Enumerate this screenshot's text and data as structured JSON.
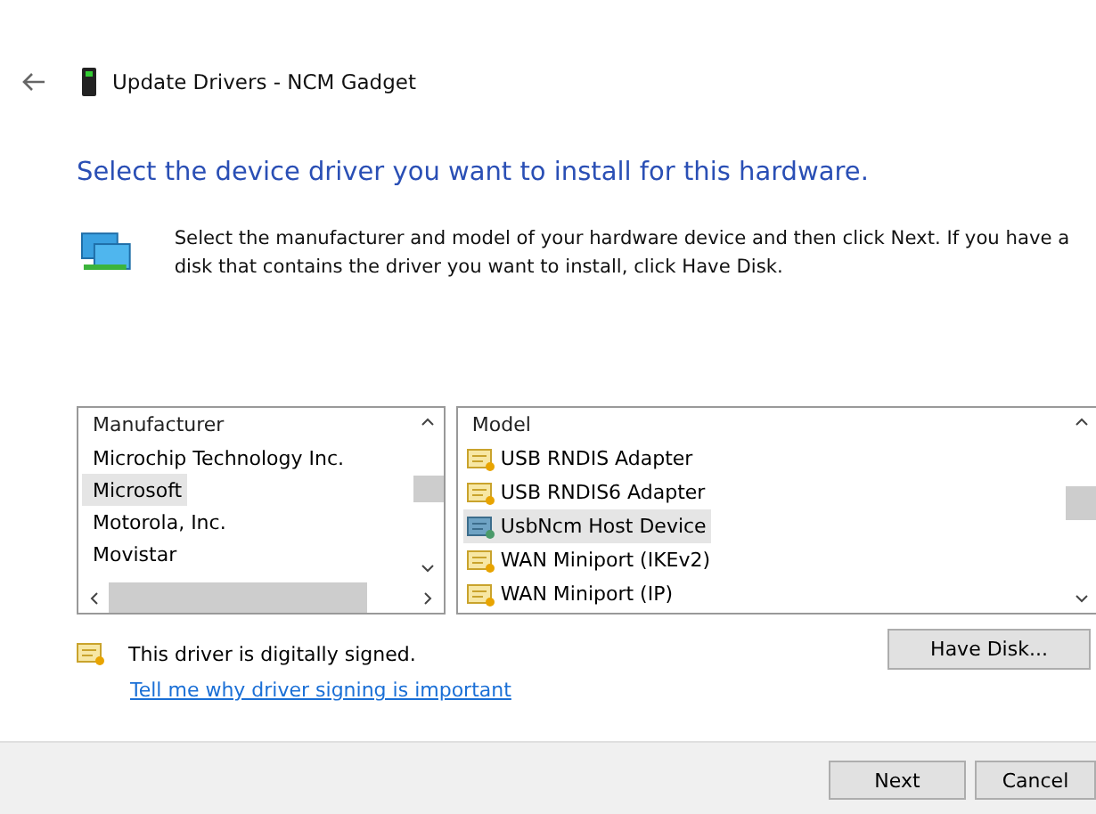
{
  "window": {
    "title": "Update Drivers - NCM Gadget"
  },
  "heading": "Select the device driver you want to install for this hardware.",
  "instructions": "Select the manufacturer and model of your hardware device and then click Next. If you have a disk that contains the driver you want to install, click Have Disk.",
  "manufacturer_list": {
    "header": "Manufacturer",
    "items": [
      {
        "label": "Microchip Technology Inc.",
        "selected": false
      },
      {
        "label": "Microsoft",
        "selected": true
      },
      {
        "label": "Motorola, Inc.",
        "selected": false
      },
      {
        "label": "Movistar",
        "selected": false
      }
    ]
  },
  "model_list": {
    "header": "Model",
    "items": [
      {
        "label": "USB RNDIS Adapter",
        "selected": false
      },
      {
        "label": "USB RNDIS6 Adapter",
        "selected": false
      },
      {
        "label": "UsbNcm Host Device",
        "selected": true
      },
      {
        "label": "WAN Miniport (IKEv2)",
        "selected": false
      },
      {
        "label": "WAN Miniport (IP)",
        "selected": false
      }
    ]
  },
  "signature": {
    "text": "This driver is digitally signed.",
    "link": "Tell me why driver signing is important"
  },
  "have_disk_button": "Have Disk...",
  "buttons": [
    "Next",
    "Cancel"
  ]
}
